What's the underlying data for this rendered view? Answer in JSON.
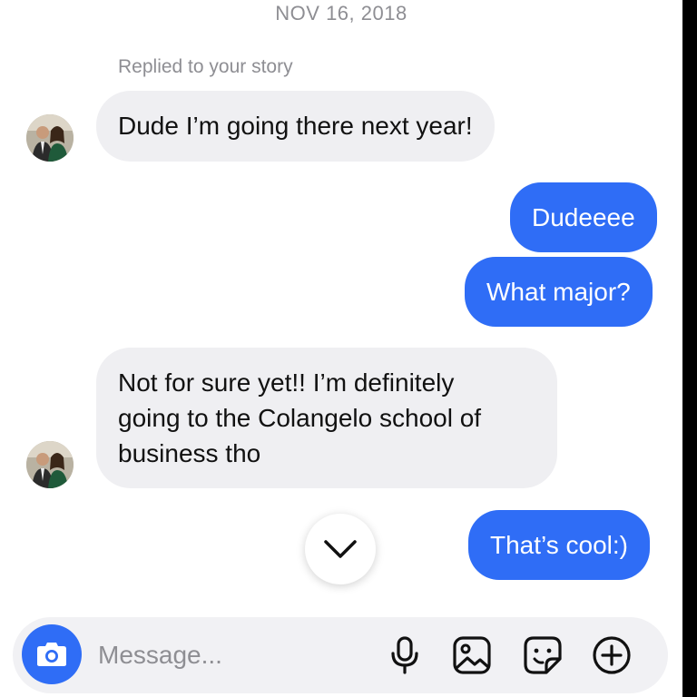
{
  "date_header": "NOV 16, 2018",
  "reply_context": "Replied to your story",
  "messages": [
    {
      "sender": "them",
      "text": "Dude I’m going there next year!"
    },
    {
      "sender": "me",
      "text": "Dudeeee"
    },
    {
      "sender": "me",
      "text": "What major?"
    },
    {
      "sender": "them",
      "lines": [
        "Not for sure yet!! I’m definitely",
        "going to the Colangelo school of",
        "business tho"
      ]
    },
    {
      "sender": "me",
      "text": "That’s cool:)"
    }
  ],
  "composer": {
    "placeholder": "Message..."
  },
  "icons": {
    "camera": "camera-icon",
    "microphone": "microphone-icon",
    "gallery": "image-icon",
    "sticker": "sticker-icon",
    "add": "plus-circle-icon",
    "scroll_down": "chevron-down-icon"
  },
  "colors": {
    "outgoing_bubble": "#2f6df6",
    "incoming_bubble": "#efeff2",
    "meta_text": "#8e8e93"
  }
}
